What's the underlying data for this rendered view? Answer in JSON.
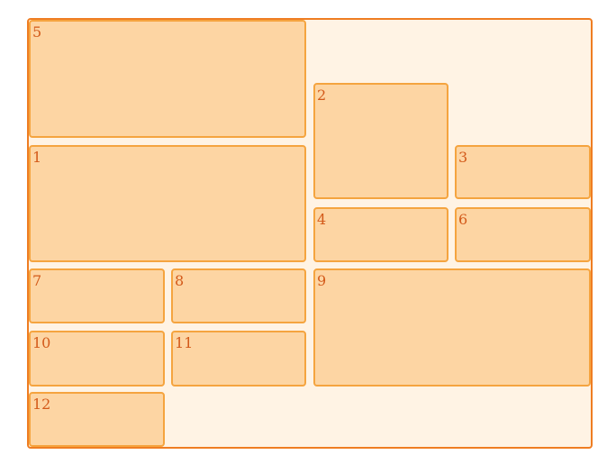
{
  "items": [
    {
      "id": "5",
      "label": "5"
    },
    {
      "id": "2",
      "label": "2"
    },
    {
      "id": "1",
      "label": "1"
    },
    {
      "id": "3",
      "label": "3"
    },
    {
      "id": "4",
      "label": "4"
    },
    {
      "id": "6",
      "label": "6"
    },
    {
      "id": "7",
      "label": "7"
    },
    {
      "id": "8",
      "label": "8"
    },
    {
      "id": "9",
      "label": "9"
    },
    {
      "id": "10",
      "label": "10"
    },
    {
      "id": "11",
      "label": "11"
    },
    {
      "id": "12",
      "label": "12"
    }
  ],
  "colors": {
    "container_border": "#ef7d22",
    "container_background": "#fff3e4",
    "box_border": "#f5a43f",
    "box_background": "#fdd5a3",
    "label_text": "#d35a1a"
  }
}
